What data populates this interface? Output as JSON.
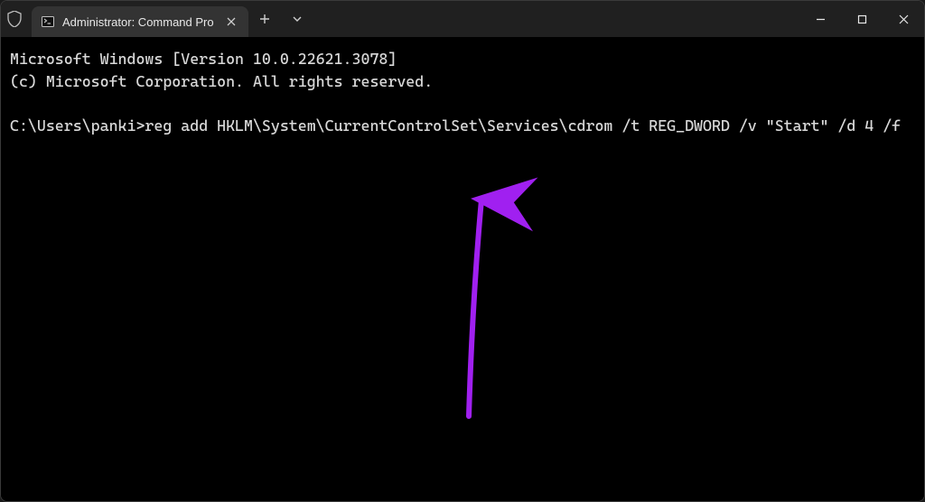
{
  "titlebar": {
    "tab_title": "Administrator: Command Pro",
    "tab_icon_name": "terminal-icon"
  },
  "terminal": {
    "line1": "Microsoft Windows [Version 10.0.22621.3078]",
    "line2": "(c) Microsoft Corporation. All rights reserved.",
    "blank": "",
    "prompt": "C:\\Users\\panki>",
    "command": "reg add HKLM\\System\\CurrentControlSet\\Services\\cdrom /t REG_DWORD /v \"Start\" /d 4 /f"
  },
  "annotation": {
    "arrow_color": "#a020f0"
  }
}
